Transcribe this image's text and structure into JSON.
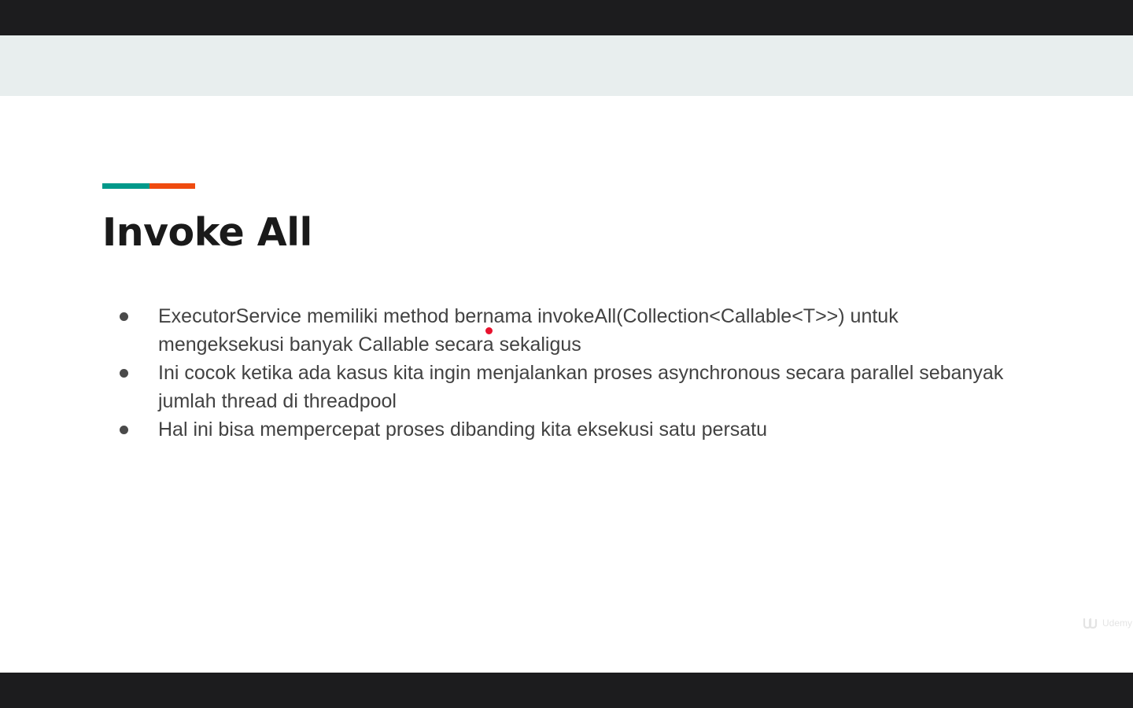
{
  "slide": {
    "title": "Invoke All",
    "bullets": [
      "ExecutorService memiliki method bernama  invokeAll(Collection<Callable<T>>) untuk mengeksekusi banyak Callable secara sekaligus",
      "Ini cocok ketika ada kasus kita ingin menjalankan proses asynchronous secara parallel sebanyak jumlah thread di threadpool",
      "Hal ini bisa mempercepat proses dibanding kita eksekusi satu persatu"
    ],
    "accent_colors": {
      "teal": "#00998a",
      "orange": "#ef4b0f"
    }
  },
  "watermark": {
    "icon": "udemy-logo-icon",
    "label": "Udemy"
  },
  "pointer": {
    "icon": "laser-pointer-icon",
    "color": "#e8112d"
  }
}
